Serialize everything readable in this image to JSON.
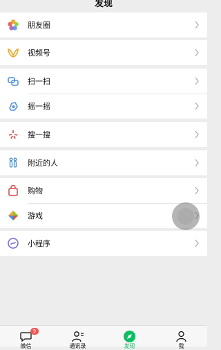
{
  "header": {
    "title": "发现"
  },
  "groups": [
    [
      {
        "label": "朋友圈",
        "icon": "moments-icon"
      }
    ],
    [
      {
        "label": "视频号",
        "icon": "channels-icon"
      }
    ],
    [
      {
        "label": "扫一扫",
        "icon": "scan-icon"
      },
      {
        "label": "摇一摇",
        "icon": "shake-icon"
      }
    ],
    [
      {
        "label": "搜一搜",
        "icon": "search-icon"
      }
    ],
    [
      {
        "label": "附近的人",
        "icon": "nearby-icon"
      }
    ],
    [
      {
        "label": "购物",
        "icon": "shopping-bag-icon"
      },
      {
        "label": "游戏",
        "icon": "games-icon"
      }
    ],
    [
      {
        "label": "小程序",
        "icon": "mini-programs-icon"
      }
    ]
  ],
  "tabbar": {
    "tabs": [
      {
        "label": "微信",
        "icon": "chat-icon",
        "badge": "9"
      },
      {
        "label": "通讯录",
        "icon": "contacts-icon"
      },
      {
        "label": "发现",
        "icon": "discover-icon",
        "active": true
      },
      {
        "label": "我",
        "icon": "me-icon"
      }
    ]
  },
  "colors": {
    "accent": "#07c160",
    "badge": "#fa5151",
    "background": "#ededed"
  }
}
